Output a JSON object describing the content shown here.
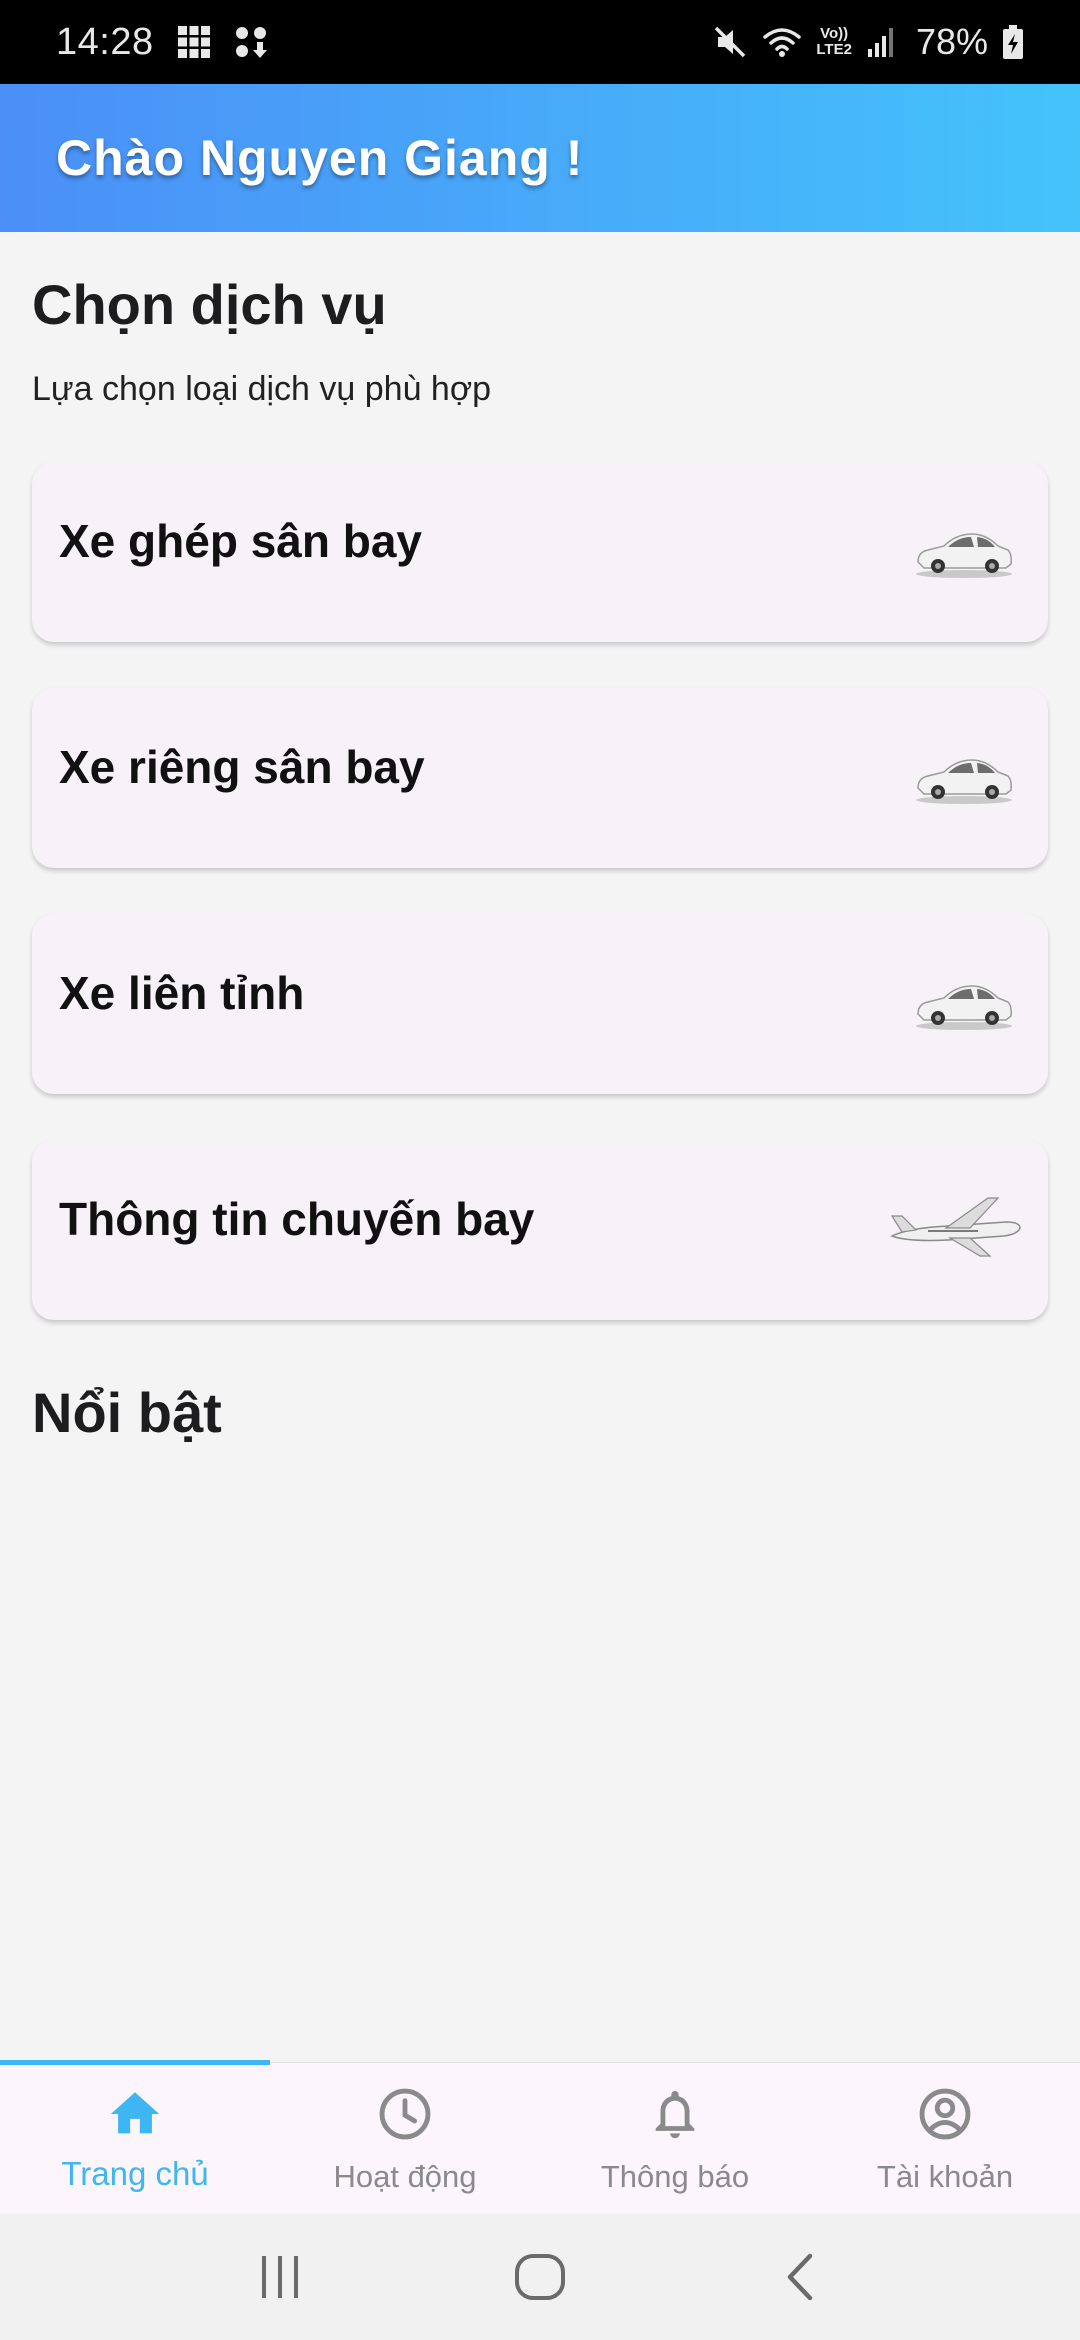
{
  "status_bar": {
    "time": "14:28",
    "volte_top": "Vo))",
    "volte_bottom": "LTE2",
    "battery": "78%",
    "icons": [
      "grid-icon",
      "download-icon",
      "mute-icon",
      "wifi-icon",
      "signal-icon",
      "battery-charging-icon"
    ]
  },
  "header": {
    "title": "Chào Nguyen Giang !"
  },
  "services": {
    "title": "Chọn dịch vụ",
    "subtitle": "Lựa chọn loại dịch vụ phù hợp",
    "items": [
      {
        "label": "Xe ghép sân bay",
        "icon": "car-icon"
      },
      {
        "label": "Xe riêng sân bay",
        "icon": "car-icon"
      },
      {
        "label": "Xe liên tỉnh",
        "icon": "car-icon"
      },
      {
        "label": "Thông tin chuyến bay",
        "icon": "airplane-icon"
      }
    ]
  },
  "featured": {
    "title": "Nổi bật"
  },
  "bottom_nav": {
    "items": [
      {
        "label": "Trang chủ",
        "icon": "home-icon",
        "active": true
      },
      {
        "label": "Hoạt động",
        "icon": "clock-icon",
        "active": false
      },
      {
        "label": "Thông báo",
        "icon": "bell-icon",
        "active": false
      },
      {
        "label": "Tài khoản",
        "icon": "account-icon",
        "active": false
      }
    ],
    "active_color": "#3fb6f4",
    "inactive_color": "#8a8a8a"
  },
  "colors": {
    "header_gradient_start": "#4b8ff7",
    "header_gradient_end": "#44c3fb",
    "card_background": "#f6f2f8"
  }
}
